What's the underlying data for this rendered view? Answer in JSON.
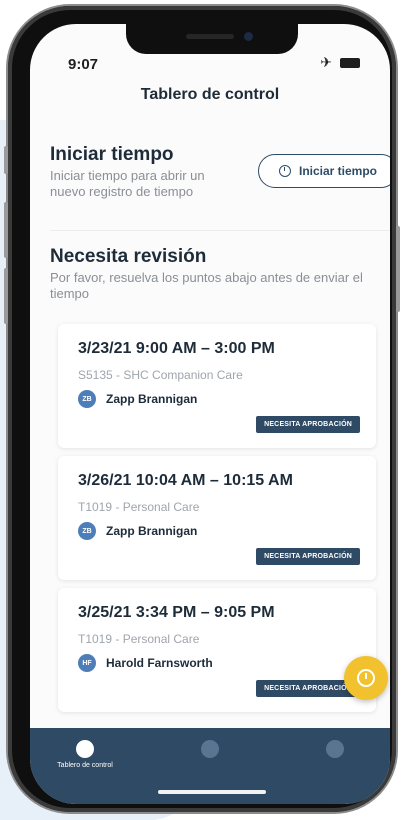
{
  "status_bar": {
    "time": "9:07",
    "airplane_icon": "airplane-icon",
    "battery_icon": "battery-icon"
  },
  "header": {
    "title": "Tablero de control"
  },
  "start_time": {
    "title": "Iniciar tiempo",
    "description": "Iniciar tiempo para abrir un nuevo registro de tiempo",
    "button_label": "Iniciar tiempo",
    "button_icon": "clock-icon"
  },
  "review": {
    "title": "Necesita revisión",
    "description": "Por favor, resuelva los puntos abajo antes de enviar el tiempo",
    "items": [
      {
        "time": "3/23/21 9:00 AM – 3:00 PM",
        "service": "S5135 - SHC Companion Care",
        "initials": "ZB",
        "name": "Zapp Brannigan",
        "badge": "NECESITA APROBACIÓN"
      },
      {
        "time": "3/26/21 10:04 AM – 10:15 AM",
        "service": "T1019 - Personal Care",
        "initials": "ZB",
        "name": "Zapp Brannigan",
        "badge": "NECESITA APROBACIÓN"
      },
      {
        "time": "3/25/21 3:34 PM – 9:05 PM",
        "service": "T1019 - Personal Care",
        "initials": "HF",
        "name": "Harold Farnsworth",
        "badge": "NECESITA APROBACIÓN"
      }
    ]
  },
  "fab": {
    "icon": "clock-icon"
  },
  "tabs": [
    {
      "label": "Tablero de control",
      "icon": "dashboard-icon"
    },
    {
      "label": "",
      "icon": "clock-icon"
    },
    {
      "label": "",
      "icon": "account-icon"
    }
  ],
  "colors": {
    "navy": "#2f4a64",
    "accent": "#f2c12e",
    "avatar": "#4e7eb8"
  }
}
